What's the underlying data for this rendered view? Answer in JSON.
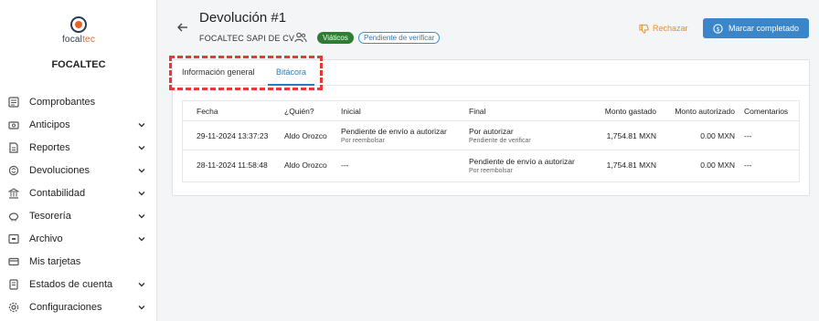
{
  "sidebar": {
    "logo_main": "focal",
    "logo_accent": "tec",
    "company": "FOCALTEC",
    "items": [
      {
        "label": "Comprobantes",
        "icon": "receipt-icon",
        "expandable": false
      },
      {
        "label": "Anticipos",
        "icon": "cash-icon",
        "expandable": true
      },
      {
        "label": "Reportes",
        "icon": "report-icon",
        "expandable": true
      },
      {
        "label": "Devoluciones",
        "icon": "refund-icon",
        "expandable": true
      },
      {
        "label": "Contabilidad",
        "icon": "bank-icon",
        "expandable": true
      },
      {
        "label": "Tesorería",
        "icon": "piggy-bank-icon",
        "expandable": true
      },
      {
        "label": "Archivo",
        "icon": "archive-icon",
        "expandable": true
      },
      {
        "label": "Mis tarjetas",
        "icon": "credit-card-icon",
        "expandable": false
      },
      {
        "label": "Estados de cuenta",
        "icon": "statement-icon",
        "expandable": true
      },
      {
        "label": "Configuraciones",
        "icon": "gear-icon",
        "expandable": true
      }
    ]
  },
  "header": {
    "title": "Devolución #1",
    "company": "FOCALTEC SAPI DE CV",
    "badge_type": "Viáticos",
    "badge_status": "Pendiente de verificar",
    "reject_label": "Rechazar",
    "complete_label": "Marcar completado"
  },
  "tabs": [
    {
      "label": "Información general",
      "active": false
    },
    {
      "label": "Bitácora",
      "active": true
    }
  ],
  "table": {
    "columns": [
      "Fecha",
      "¿Quién?",
      "Inicial",
      "Final",
      "Monto gastado",
      "Monto autorizado",
      "Comentarios"
    ],
    "rows": [
      {
        "fecha": "29-11-2024 13:37:23",
        "quien": "Aldo Orozco",
        "inicial": "Pendiente de envío a autorizar",
        "inicial_sub": "Por reembolsar",
        "final": "Por autorizar",
        "final_sub": "Pendiente de verificar",
        "monto_gastado": "1,754.81 MXN",
        "monto_autorizado": "0.00 MXN",
        "comentarios": "---"
      },
      {
        "fecha": "28-11-2024 11:58:48",
        "quien": "Aldo Orozco",
        "inicial": "---",
        "inicial_sub": "",
        "final": "Pendiente de envío a autorizar",
        "final_sub": "Por reembolsar",
        "monto_gastado": "1,754.81 MXN",
        "monto_autorizado": "0.00 MXN",
        "comentarios": "---"
      }
    ]
  },
  "colors": {
    "accent": "#3a86c8",
    "status_green": "#2e7d32",
    "reject_orange": "#e8902a",
    "highlight_red": "#e53935"
  }
}
